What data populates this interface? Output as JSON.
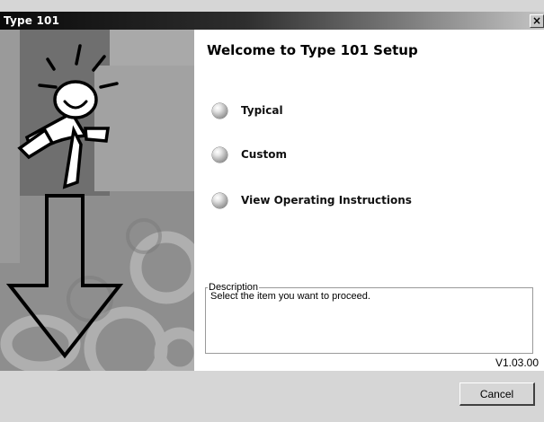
{
  "window": {
    "title": "Type 101",
    "close_label": "×"
  },
  "content": {
    "heading": "Welcome to Type 101 Setup",
    "options": [
      {
        "label": "Typical"
      },
      {
        "label": "Custom"
      },
      {
        "label": "View Operating Instructions"
      }
    ],
    "description": {
      "legend": "Description",
      "text": "Select the item you want to proceed."
    },
    "version": "V1.03.00"
  },
  "footer": {
    "cancel_label": "Cancel"
  },
  "colors": {
    "title_bar_dark": "#0a0a0a",
    "title_bar_light": "#c4c4c4",
    "dialog_gray": "#d6d6d6"
  },
  "icons": {
    "side_image": "running-figure-with-down-arrow",
    "option_bullet": "gray-sphere-icon"
  }
}
